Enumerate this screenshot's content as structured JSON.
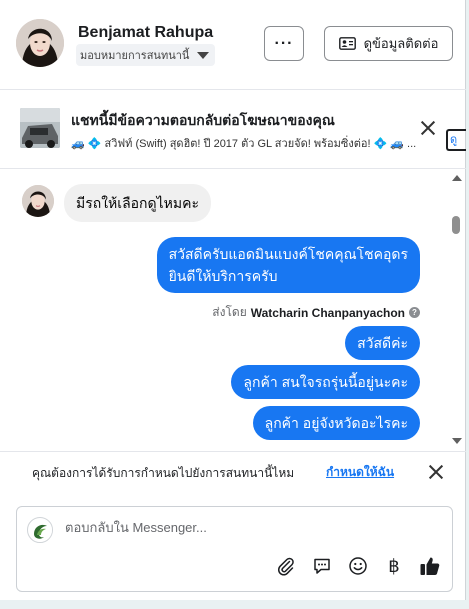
{
  "header": {
    "name": "Benjamat Rahupa",
    "assign_label": "มอบหมายการสนทนานี้",
    "more_label": "···",
    "contact_label": "ดูข้อมูลติดต่อ"
  },
  "ad": {
    "title": "แชทนี้มีข้อความตอบกลับต่อโฆษณาของคุณ",
    "subtitle": "🚙 💠 สวิฟท์ (Swift) สุดฮิต! ปี 2017 ตัว GL สวยจัด! พร้อมซิ่งต่อ! 💠 🚙 ...",
    "view_label": "ดู"
  },
  "messages": {
    "incoming": "มีรถให้เลือกดูไหมคะ",
    "outgoing": [
      "สวัสดีครับแอดมินแบงค์โชคคุณโชคอุดร",
      "ยินดีให้บริการครับ",
      "สวัสดีค่ะ",
      "ลูกค้า สนใจรถรุ่นนี้อยู่นะคะ",
      "ลูกค้า อยู่จังหวัดอะไรคะ"
    ],
    "sent_by_prefix": "ส่งโดย",
    "sent_by_name": "Watcharin Chanpanyachon",
    "help_glyph": "?"
  },
  "prompt": {
    "text": "คุณต้องการได้รับการกำหนดไปยังการสนทนานี้ไหม",
    "link": "กำหนดให้ฉัน"
  },
  "composer": {
    "placeholder": "ตอบกลับใน Messenger...",
    "baht_glyph": "฿"
  },
  "colors": {
    "accent": "#1877f2",
    "incoming_bubble": "#f0f0f0"
  },
  "icons": [
    "dots-icon",
    "contact-card-icon",
    "chevron-down-icon",
    "close-icon",
    "help-icon",
    "attachment-icon",
    "saved-reply-icon",
    "emoji-icon",
    "baht-icon",
    "thumbs-up-icon"
  ]
}
